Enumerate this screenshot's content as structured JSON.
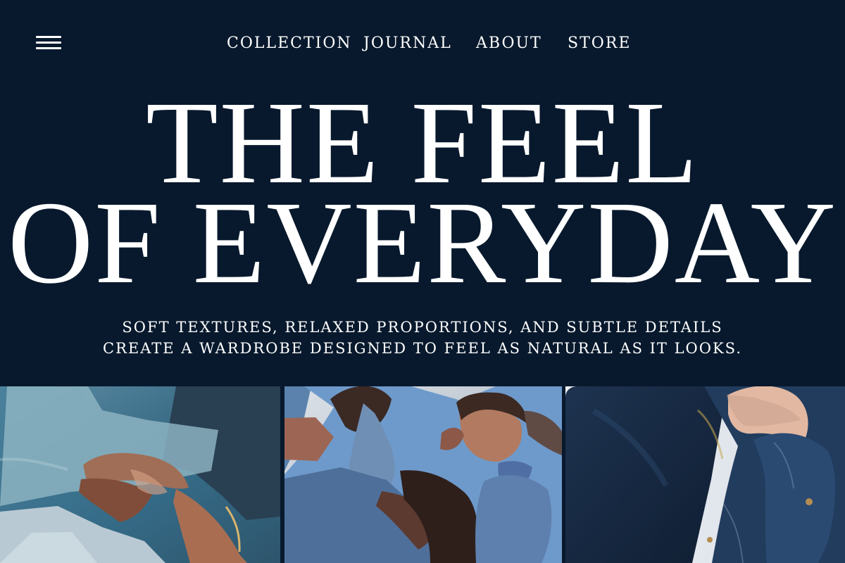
{
  "nav": {
    "menu_icon": "hamburger-menu-icon",
    "links": [
      {
        "label": "COLLECTION"
      },
      {
        "label": "JOURNAL"
      },
      {
        "label": "ABOUT"
      },
      {
        "label": "STORE"
      }
    ]
  },
  "hero": {
    "title_line1": "THE FEEL",
    "title_line2": "OF EVERYDAY",
    "subtitle_line1": "SOFT TEXTURES, RELAXED PROPORTIONS, AND SUBTLE DETAILS",
    "subtitle_line2": "CREATE A WARDROBE DESIGNED TO FEEL AS NATURAL AS IT LOOKS."
  },
  "colors": {
    "background": "#08192d",
    "text": "#ffffff"
  }
}
